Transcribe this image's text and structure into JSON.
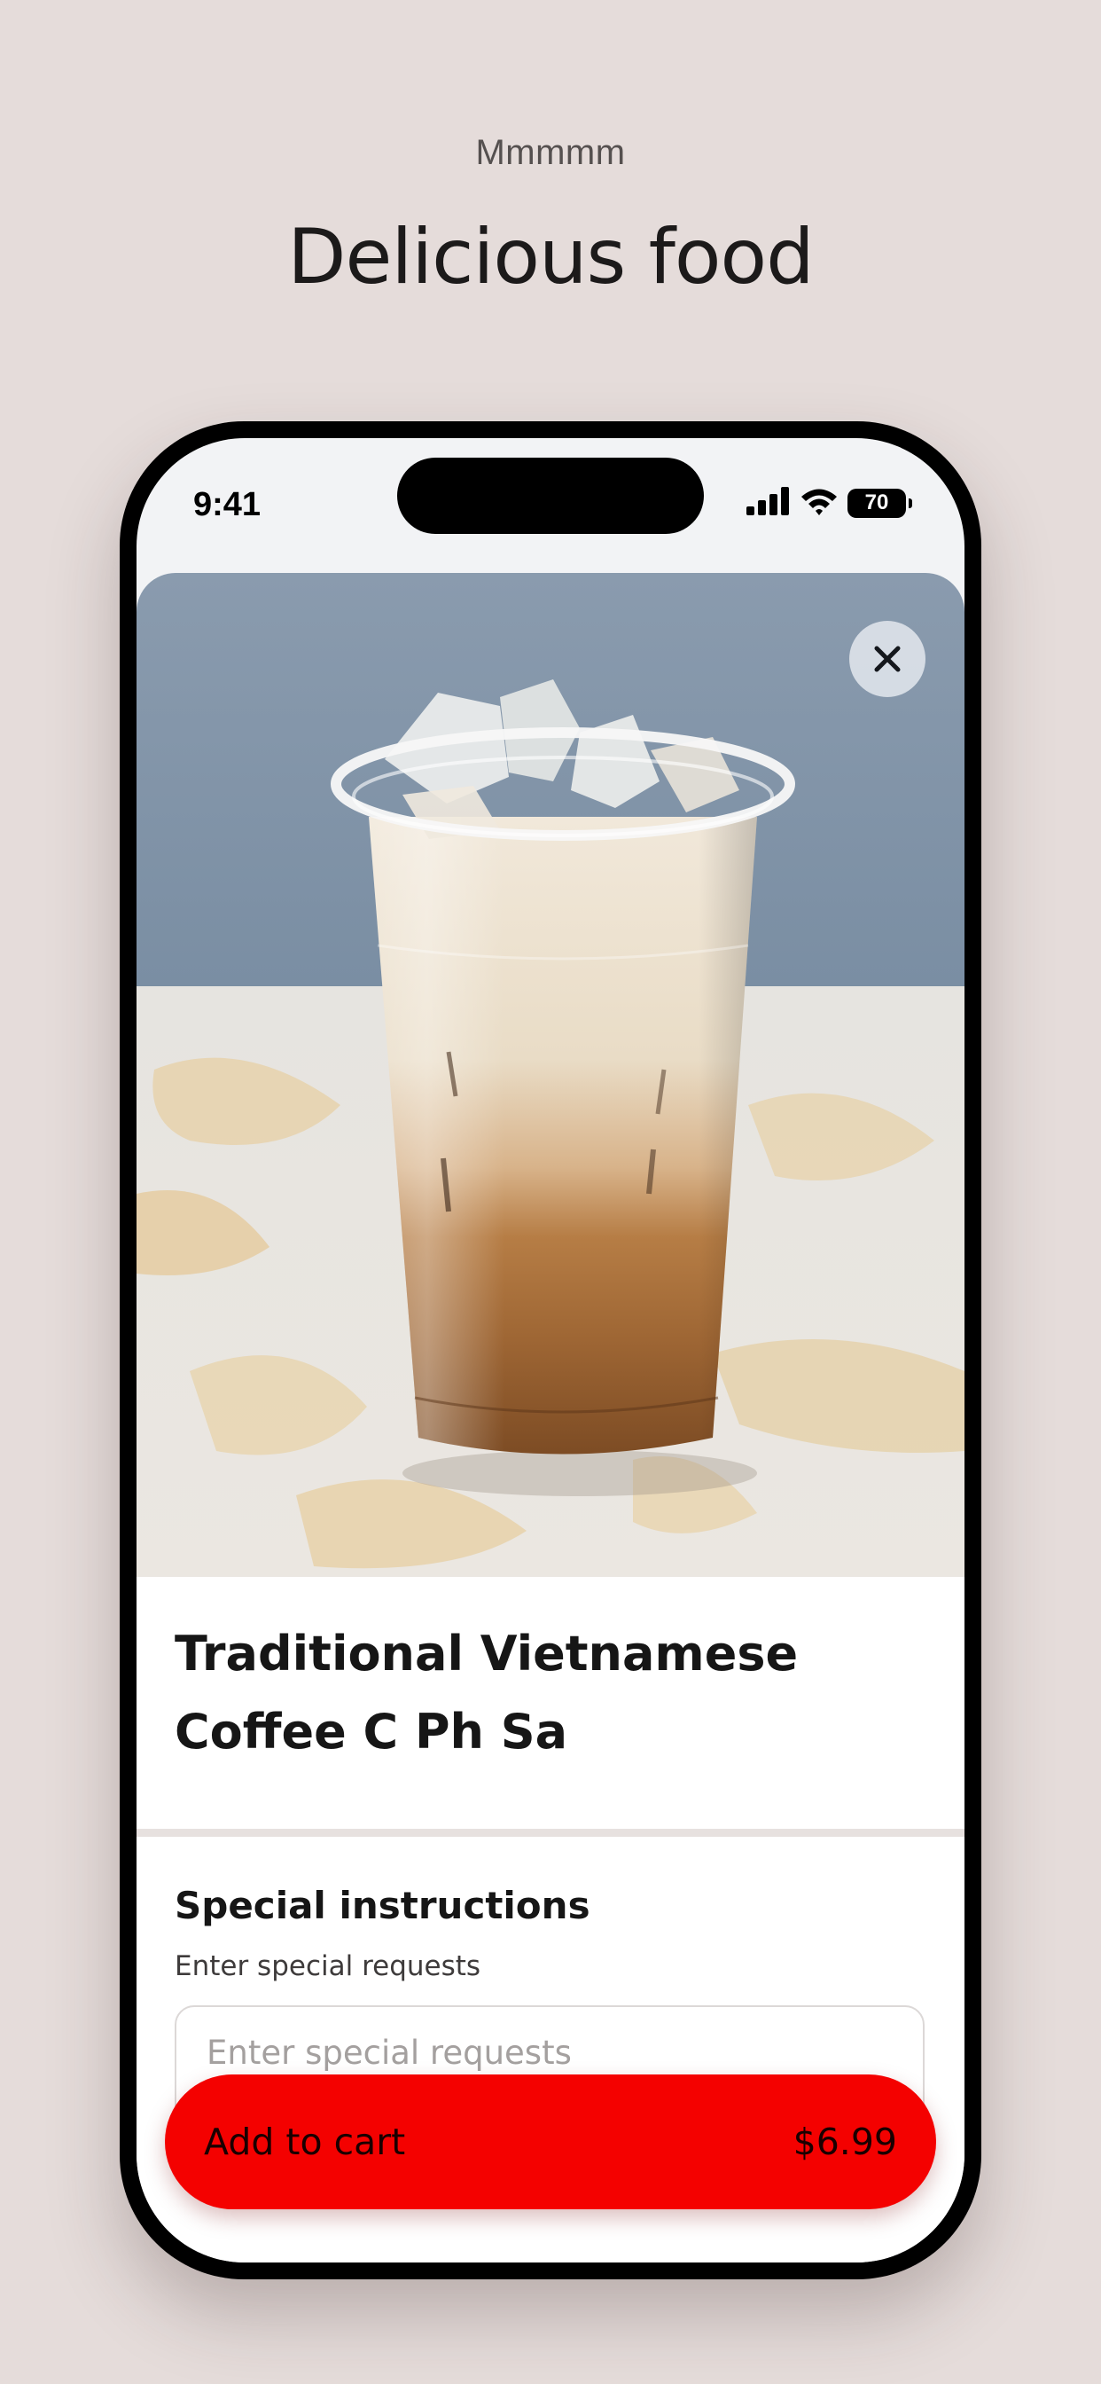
{
  "header": {
    "eyebrow": "Mmmmm",
    "headline": "Delicious food"
  },
  "status_bar": {
    "time": "9:41",
    "battery": "70"
  },
  "product": {
    "image_icon": "iced-coffee-photo",
    "close_icon": "close-icon",
    "name": "Traditional Vietnamese Coffee C Ph Sa"
  },
  "special_instructions": {
    "title": "Special instructions",
    "subtitle": "Enter special requests",
    "placeholder": "Enter special requests"
  },
  "cart": {
    "label": "Add to cart",
    "price": "$6.99",
    "accent_color": "#f40100"
  },
  "colors": {
    "background": "#e5dcda"
  }
}
